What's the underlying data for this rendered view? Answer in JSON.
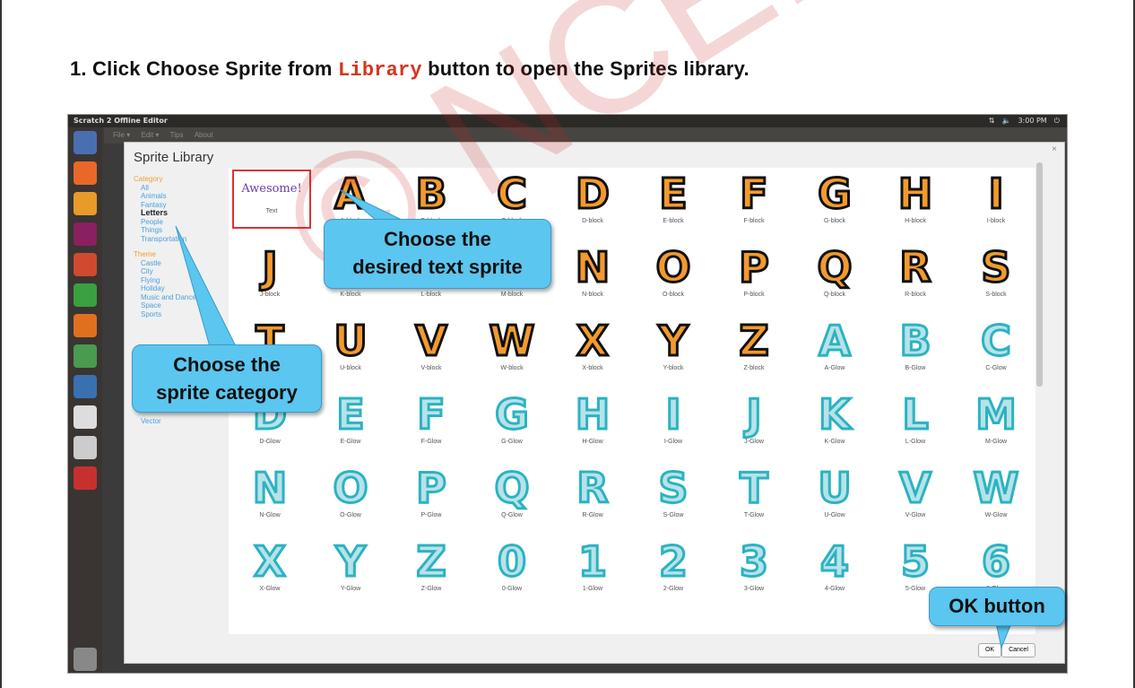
{
  "instruction": {
    "prefix": "1.  Click Choose Sprite from ",
    "code": "Library",
    "suffix": " button to open the Sprites library."
  },
  "os": {
    "window_title": "Scratch 2 Offline Editor",
    "clock": "3:00 PM",
    "menu": [
      "File ▾",
      "Edit ▾",
      "Tips",
      "About"
    ]
  },
  "dialog": {
    "title": "Sprite Library",
    "close": "×",
    "category_heading": "Category",
    "categories": [
      "All",
      "Animals",
      "Fantasy",
      "Letters",
      "People",
      "Things",
      "Transportation"
    ],
    "theme_heading": "Theme",
    "themes": [
      "Castle",
      "City",
      "Flying",
      "Holiday",
      "Music and Dance",
      "Space",
      "Sports"
    ],
    "extra": "Vector",
    "ok_label": "OK",
    "cancel_label": "Cancel"
  },
  "text_sprite": {
    "preview": "Awesome!",
    "name": "Text"
  },
  "sprites": [
    {
      "g": "A",
      "name": "A-block",
      "s": "block"
    },
    {
      "g": "B",
      "name": "B-block",
      "s": "block"
    },
    {
      "g": "C",
      "name": "C-block",
      "s": "block"
    },
    {
      "g": "D",
      "name": "D-block",
      "s": "block"
    },
    {
      "g": "E",
      "name": "E-block",
      "s": "block"
    },
    {
      "g": "F",
      "name": "F-block",
      "s": "block"
    },
    {
      "g": "G",
      "name": "G-block",
      "s": "block"
    },
    {
      "g": "H",
      "name": "H-block",
      "s": "block"
    },
    {
      "g": "I",
      "name": "I-block",
      "s": "block"
    },
    {
      "g": "J",
      "name": "J-block",
      "s": "block"
    },
    {
      "g": "K",
      "name": "K-block",
      "s": "block"
    },
    {
      "g": "L",
      "name": "L-block",
      "s": "block"
    },
    {
      "g": "M",
      "name": "M-block",
      "s": "block"
    },
    {
      "g": "N",
      "name": "N-block",
      "s": "block"
    },
    {
      "g": "O",
      "name": "O-block",
      "s": "block"
    },
    {
      "g": "P",
      "name": "P-block",
      "s": "block"
    },
    {
      "g": "Q",
      "name": "Q-block",
      "s": "block"
    },
    {
      "g": "R",
      "name": "R-block",
      "s": "block"
    },
    {
      "g": "S",
      "name": "S-block",
      "s": "block"
    },
    {
      "g": "T",
      "name": "T-block",
      "s": "block"
    },
    {
      "g": "U",
      "name": "U-block",
      "s": "block"
    },
    {
      "g": "V",
      "name": "V-block",
      "s": "block"
    },
    {
      "g": "W",
      "name": "W-block",
      "s": "block"
    },
    {
      "g": "X",
      "name": "X-block",
      "s": "block"
    },
    {
      "g": "Y",
      "name": "Y-block",
      "s": "block"
    },
    {
      "g": "Z",
      "name": "Z-block",
      "s": "block"
    },
    {
      "g": "A",
      "name": "A-Glow",
      "s": "glow"
    },
    {
      "g": "B",
      "name": "B-Glow",
      "s": "glow"
    },
    {
      "g": "C",
      "name": "C-Glow",
      "s": "glow"
    },
    {
      "g": "D",
      "name": "D-Glow",
      "s": "glow"
    },
    {
      "g": "E",
      "name": "E-Glow",
      "s": "glow"
    },
    {
      "g": "F",
      "name": "F-Glow",
      "s": "glow"
    },
    {
      "g": "G",
      "name": "G-Glow",
      "s": "glow"
    },
    {
      "g": "H",
      "name": "H-Glow",
      "s": "glow"
    },
    {
      "g": "I",
      "name": "I-Glow",
      "s": "glow"
    },
    {
      "g": "J",
      "name": "J-Glow",
      "s": "glow"
    },
    {
      "g": "K",
      "name": "K-Glow",
      "s": "glow"
    },
    {
      "g": "L",
      "name": "L-Glow",
      "s": "glow"
    },
    {
      "g": "M",
      "name": "M-Glow",
      "s": "glow"
    },
    {
      "g": "N",
      "name": "N-Glow",
      "s": "glow"
    },
    {
      "g": "O",
      "name": "O-Glow",
      "s": "glow"
    },
    {
      "g": "P",
      "name": "P-Glow",
      "s": "glow"
    },
    {
      "g": "Q",
      "name": "Q-Glow",
      "s": "glow"
    },
    {
      "g": "R",
      "name": "R-Glow",
      "s": "glow"
    },
    {
      "g": "S",
      "name": "S-Glow",
      "s": "glow"
    },
    {
      "g": "T",
      "name": "T-Glow",
      "s": "glow"
    },
    {
      "g": "U",
      "name": "U-Glow",
      "s": "glow"
    },
    {
      "g": "V",
      "name": "V-Glow",
      "s": "glow"
    },
    {
      "g": "W",
      "name": "W-Glow",
      "s": "glow"
    },
    {
      "g": "X",
      "name": "X-Glow",
      "s": "glow"
    },
    {
      "g": "Y",
      "name": "Y-Glow",
      "s": "glow"
    },
    {
      "g": "Z",
      "name": "Z-Glow",
      "s": "glow"
    },
    {
      "g": "0",
      "name": "0-Glow",
      "s": "glow"
    },
    {
      "g": "1",
      "name": "1-Glow",
      "s": "glow"
    },
    {
      "g": "2",
      "name": "2-Glow",
      "s": "glow"
    },
    {
      "g": "3",
      "name": "3-Glow",
      "s": "glow"
    },
    {
      "g": "4",
      "name": "4-Glow",
      "s": "glow"
    },
    {
      "g": "5",
      "name": "5-Glow",
      "s": "glow"
    },
    {
      "g": "6",
      "name": "6-Glow",
      "s": "glow"
    }
  ],
  "callouts": {
    "text_sprite": [
      "Choose the",
      "desired text sprite"
    ],
    "category": [
      "Choose the",
      "sprite category"
    ],
    "ok": "OK button"
  },
  "watermark": "© NCERT not to be republished",
  "colors": {
    "callout": "#5bc6ef",
    "highlight": "#d33333",
    "block_fill": "#f29a2e",
    "glow": "#2bb3c0",
    "category_heading": "#f0a030",
    "link": "#4aa0e0"
  }
}
